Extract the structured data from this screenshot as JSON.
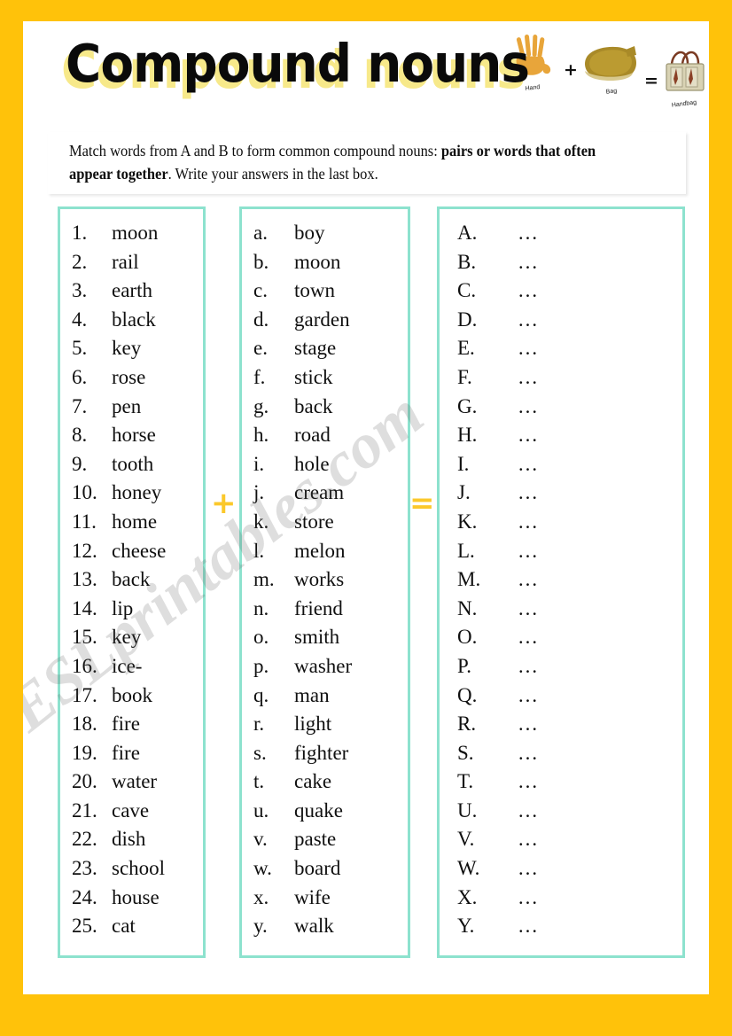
{
  "title": "Compound nouns",
  "header_equation": {
    "items": [
      {
        "icon": "hand-icon",
        "caption": "Hand"
      },
      {
        "icon": "bag-icon",
        "caption": "Bag"
      },
      {
        "icon": "handbag-icon",
        "caption": "Handbag"
      }
    ],
    "plus": "+",
    "equals": "="
  },
  "instructions": {
    "part1": "Match words from A and B to form common compound nouns: ",
    "part2_bold": "pairs or words that often appear together",
    "part3": ".  Write your answers in the last box."
  },
  "separators": {
    "plus": "+",
    "equals": "="
  },
  "columns": {
    "a": {
      "name": "column-a-words",
      "rows": [
        {
          "mark": "1.",
          "word": "moon"
        },
        {
          "mark": "2.",
          "word": "rail"
        },
        {
          "mark": "3.",
          "word": "earth"
        },
        {
          "mark": "4.",
          "word": "black"
        },
        {
          "mark": "5.",
          "word": "key"
        },
        {
          "mark": "6.",
          "word": "rose"
        },
        {
          "mark": "7.",
          "word": "pen"
        },
        {
          "mark": "8.",
          "word": "horse"
        },
        {
          "mark": "9.",
          "word": "tooth"
        },
        {
          "mark": "10.",
          "word": "honey"
        },
        {
          "mark": "11.",
          "word": "home"
        },
        {
          "mark": "12.",
          "word": "cheese"
        },
        {
          "mark": "13.",
          "word": "back"
        },
        {
          "mark": "14.",
          "word": "lip"
        },
        {
          "mark": "15.",
          "word": "key"
        },
        {
          "mark": "16.",
          "word": "ice-"
        },
        {
          "mark": "17.",
          "word": "book"
        },
        {
          "mark": "18.",
          "word": "fire"
        },
        {
          "mark": "19.",
          "word": "fire"
        },
        {
          "mark": "20.",
          "word": "water"
        },
        {
          "mark": "21.",
          "word": "cave"
        },
        {
          "mark": "22.",
          "word": "dish"
        },
        {
          "mark": "23.",
          "word": "school"
        },
        {
          "mark": "24.",
          "word": "house"
        },
        {
          "mark": "25.",
          "word": "cat"
        }
      ]
    },
    "b": {
      "name": "column-b-words",
      "rows": [
        {
          "mark": "a.",
          "word": "boy"
        },
        {
          "mark": "b.",
          "word": "moon"
        },
        {
          "mark": "c.",
          "word": "town"
        },
        {
          "mark": "d.",
          "word": "garden"
        },
        {
          "mark": "e.",
          "word": "stage"
        },
        {
          "mark": "f.",
          "word": "stick"
        },
        {
          "mark": "g.",
          "word": "back"
        },
        {
          "mark": "h.",
          "word": "road"
        },
        {
          "mark": "i.",
          "word": "hole"
        },
        {
          "mark": "j.",
          "word": "cream"
        },
        {
          "mark": "k.",
          "word": "store"
        },
        {
          "mark": "l.",
          "word": "melon"
        },
        {
          "mark": "m.",
          "word": "works"
        },
        {
          "mark": "n.",
          "word": "friend"
        },
        {
          "mark": "o.",
          "word": "smith"
        },
        {
          "mark": "p.",
          "word": "washer"
        },
        {
          "mark": "q.",
          "word": "man"
        },
        {
          "mark": "r.",
          "word": "light"
        },
        {
          "mark": "s.",
          "word": "fighter"
        },
        {
          "mark": "t.",
          "word": "cake"
        },
        {
          "mark": "u.",
          "word": "quake"
        },
        {
          "mark": "v.",
          "word": "paste"
        },
        {
          "mark": "w.",
          "word": "board"
        },
        {
          "mark": "x.",
          "word": "wife"
        },
        {
          "mark": "y.",
          "word": "walk"
        }
      ]
    },
    "c": {
      "name": "column-c-answers",
      "rows": [
        {
          "mark": "A.",
          "word": "…"
        },
        {
          "mark": "B.",
          "word": "…"
        },
        {
          "mark": "C.",
          "word": "…"
        },
        {
          "mark": "D.",
          "word": "…"
        },
        {
          "mark": "E.",
          "word": "…"
        },
        {
          "mark": "F.",
          "word": "…"
        },
        {
          "mark": "G.",
          "word": "…"
        },
        {
          "mark": "H.",
          "word": "…"
        },
        {
          "mark": "I.",
          "word": "…"
        },
        {
          "mark": "J.",
          "word": "…"
        },
        {
          "mark": "K.",
          "word": "…"
        },
        {
          "mark": "L.",
          "word": "…"
        },
        {
          "mark": "M.",
          "word": "…"
        },
        {
          "mark": "N.",
          "word": "…"
        },
        {
          "mark": "O.",
          "word": "…"
        },
        {
          "mark": "P.",
          "word": "…"
        },
        {
          "mark": "Q.",
          "word": "…"
        },
        {
          "mark": "R.",
          "word": "…"
        },
        {
          "mark": "S.",
          "word": "…"
        },
        {
          "mark": "T.",
          "word": "…"
        },
        {
          "mark": "U.",
          "word": "…"
        },
        {
          "mark": "V.",
          "word": "…"
        },
        {
          "mark": "W.",
          "word": "…"
        },
        {
          "mark": "X.",
          "word": "…"
        },
        {
          "mark": "Y.",
          "word": "…"
        }
      ]
    }
  },
  "watermark": "ESLprintables.com",
  "colors": {
    "frame": "#FFC20A",
    "box_border": "#8DE2CE",
    "title_shadow": "#F7E98A",
    "operator": "#FBC82B"
  }
}
